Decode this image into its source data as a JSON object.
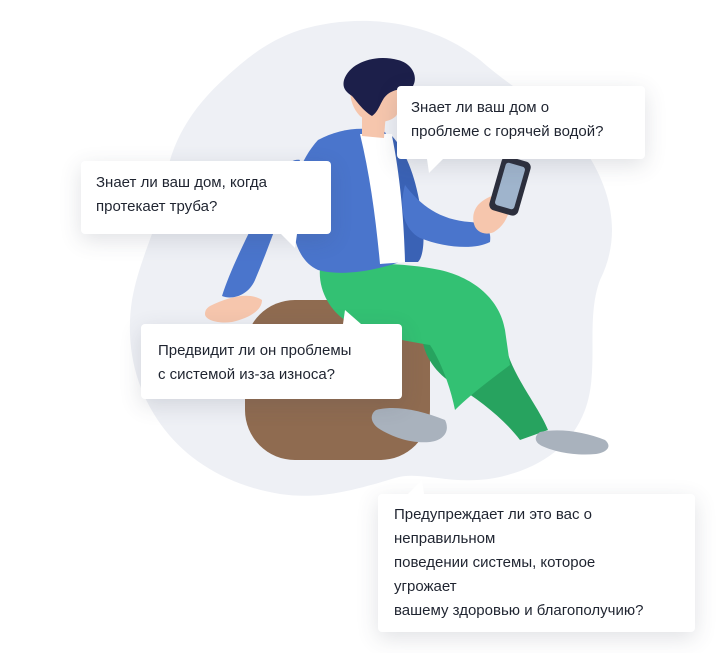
{
  "bubbles": {
    "hot_water": {
      "lines": [
        "Знает ли ваш дом о",
        "проблеме с горячей водой?"
      ]
    },
    "pipe_leak": {
      "lines": [
        "Знает ли ваш дом, когда",
        "протекает труба?"
      ]
    },
    "wear": {
      "lines": [
        "Предвидит ли он проблемы",
        "с системой из-за износа?"
      ]
    },
    "health": {
      "lines": [
        "Предупреждает ли это вас о",
        "неправильном",
        "поведении системы, которое",
        "угрожает",
        "вашему здоровью и благополучию?"
      ]
    }
  },
  "colors": {
    "blob": "#eef0f5",
    "jacket": "#4a75cc",
    "jacket_dark": "#3a62b5",
    "pants": "#33c173",
    "pants_dark": "#27a35f",
    "skin": "#f6c6ad",
    "hair": "#1c1f4a",
    "ottoman": "#8f6b50",
    "shoe": "#a9b2bd",
    "shirt": "#ffffff",
    "phone": "#2c2f3d",
    "screen": "#9fb4cc"
  },
  "icons": {
    "illustration": "person-sitting-with-phone-illustration"
  }
}
